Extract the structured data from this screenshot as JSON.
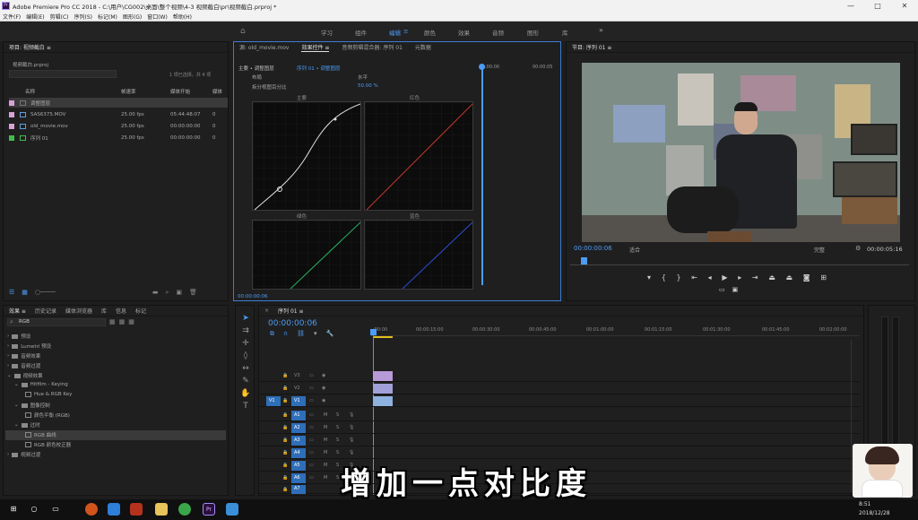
{
  "titlebar": {
    "app_icon": "Pr",
    "title": "Adobe Premiere Pro CC 2018 - C:\\用户\\CG002\\桌面\\整个视频\\4-3 视频截白\\pr\\视频截白.prproj *",
    "controls": [
      "—",
      "□",
      "✕"
    ]
  },
  "menu": [
    "文件(F)",
    "编辑(E)",
    "剪辑(C)",
    "序列(S)",
    "标记(M)",
    "图形(G)",
    "窗口(W)",
    "帮助(H)"
  ],
  "workspaces": {
    "items": [
      "学习",
      "组件",
      "编辑",
      "颜色",
      "效果",
      "音频",
      "图形",
      "库"
    ],
    "active": "编辑",
    "more": "»"
  },
  "project": {
    "tab_label": "项目: 视频截白 ≡",
    "file": "视频截白.prproj",
    "selection_info": "1 项已选择，共 4 项",
    "columns": [
      "名称",
      "帧速率",
      "媒体开始",
      "媒体"
    ],
    "items": [
      {
        "name": "调整图层",
        "fps": "",
        "start": "",
        "color": "#d8a1d8",
        "selected": true
      },
      {
        "name": "SAS6375.MOV",
        "fps": "25.00 fps",
        "start": "05:44:48:07",
        "end": "0",
        "color": "#d8a1d8"
      },
      {
        "name": "old_movie.mov",
        "fps": "25.00 fps",
        "start": "00:00:00:00",
        "end": "0",
        "color": "#d8a1d8"
      },
      {
        "name": "序列 01",
        "fps": "25.00 fps",
        "start": "00:00:00:00",
        "end": "0",
        "color": "#3fbf4b"
      }
    ]
  },
  "effect_controls": {
    "tabs": [
      "源: old_movie.mov",
      "效果控件 ≡",
      "音频剪辑混合器: 序列 01",
      "元数据"
    ],
    "active_tab": "效果控件 ≡",
    "master_path": "主要 • 调整图层",
    "seq_path": "序列 01 • 调整图层",
    "timecode_start": ":00:00",
    "timecode_end": "00:00:05",
    "layout_label": "布局",
    "layout_value": "水平",
    "split_label": "拆分视图百分比",
    "split_value": "50.00 %",
    "graphs": [
      "主要",
      "红色",
      "绿色",
      "蓝色"
    ],
    "timecode_bottom": "00:00:00:06"
  },
  "program": {
    "tab_label": "节目: 序列 01 ≡",
    "timecode": "00:00:00:06",
    "fit": "适合",
    "quality": "完整",
    "duration": "00:00:05:16"
  },
  "effects_panel": {
    "tabs": [
      "效果 ≡",
      "历史记录",
      "媒体浏览器",
      "库",
      "信息",
      "标记"
    ],
    "search_value": "RGB",
    "tree": [
      {
        "level": 0,
        "label": "预设",
        "kind": "folder"
      },
      {
        "level": 0,
        "label": "Lumetri 预设",
        "kind": "folder"
      },
      {
        "level": 0,
        "label": "音频效果",
        "kind": "folder"
      },
      {
        "level": 0,
        "label": "音频过渡",
        "kind": "folder"
      },
      {
        "level": 0,
        "label": "视频效果",
        "kind": "folder",
        "open": true
      },
      {
        "level": 1,
        "label": "Hitfilm - Keying",
        "kind": "folder",
        "open": true
      },
      {
        "level": 2,
        "label": "Hue & RGB Key",
        "kind": "fx"
      },
      {
        "level": 1,
        "label": "图像控制",
        "kind": "folder",
        "open": true
      },
      {
        "level": 2,
        "label": "颜色平衡 (RGB)",
        "kind": "fx"
      },
      {
        "level": 1,
        "label": "过时",
        "kind": "folder",
        "open": true
      },
      {
        "level": 2,
        "label": "RGB 曲线",
        "kind": "fx",
        "selected": true
      },
      {
        "level": 2,
        "label": "RGB 颜色校正器",
        "kind": "fx"
      },
      {
        "level": 0,
        "label": "视频过渡",
        "kind": "folder"
      }
    ]
  },
  "tools": [
    "select-tool",
    "track-select-tool",
    "ripple-tool",
    "razor-tool",
    "slip-tool",
    "pen-tool",
    "hand-tool",
    "type-tool"
  ],
  "timeline": {
    "tab_label": "序列 01 ≡",
    "timecode": "00:00:00:06",
    "ruler": [
      ":00:00",
      "00:00:15:00",
      "00:00:30:00",
      "00:00:45:00",
      "00:01:00:00",
      "00:01:15:00",
      "00:01:30:00",
      "00:01:45:00",
      "00:02:00:00"
    ],
    "video_tracks": [
      "V3",
      "V2",
      "V1"
    ],
    "audio_tracks": [
      "A1",
      "A2",
      "A3",
      "A4",
      "A5",
      "A6",
      "A7",
      "A8"
    ],
    "v1_source": "V1",
    "track_flags": [
      "M",
      "S"
    ]
  },
  "subtitle": "增加一点对比度",
  "taskbar": {
    "time": "8:51",
    "date": "2018/12/28"
  },
  "colors": {
    "accent_blue": "#4d9cf4",
    "adjustment_clip": "#b79ad8",
    "video_clip": "#8fb1e0",
    "seq_green": "#3fbf4b"
  }
}
